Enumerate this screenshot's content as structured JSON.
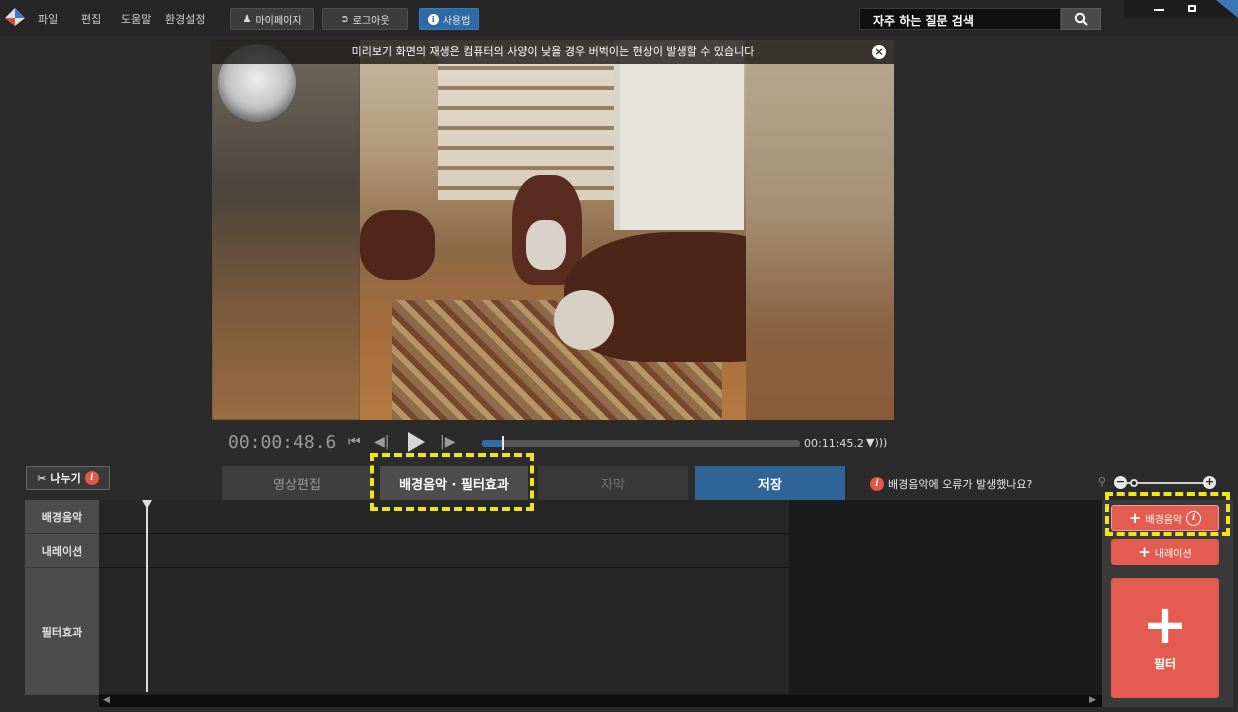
{
  "menu": {
    "items": [
      "파일",
      "편집",
      "도움말",
      "환경설정"
    ],
    "mypage": "마이페이지",
    "logout": "로그아웃",
    "howto": "사용법"
  },
  "search": {
    "value": "자주 하는 질문 검색"
  },
  "preview": {
    "notice": "미리보기 화면의 재생은 컴퓨터의 사양이 낮을 경우 버벅이는 현상이 발생할 수 있습니다",
    "close": "×"
  },
  "player": {
    "current_time": "00:00:48.6",
    "total_time": "00:11:45.2",
    "progress": 0.07
  },
  "tabs": {
    "split": "나누기",
    "edit": "영상편집",
    "bgm_filter": "배경음악 · 필터효과",
    "subtitle": "자막",
    "save": "저장"
  },
  "bgm_error": "배경음악에 오류가 발생했나요?",
  "timeline": {
    "labels": [
      "배경음악",
      "내레이션",
      "필터효과"
    ]
  },
  "right_panel": {
    "add_bgm": "배경음악",
    "add_narration": "내레이션",
    "add_filter": "필터"
  },
  "colors": {
    "accent_blue": "#2f6496",
    "add_red": "#e35c4f",
    "highlight_yellow": "#f2e31f"
  }
}
